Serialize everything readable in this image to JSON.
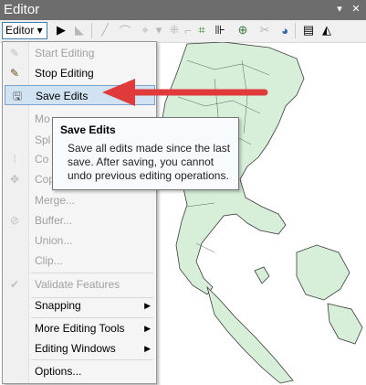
{
  "window": {
    "title": "Editor",
    "controls": [
      "▾",
      "✕"
    ]
  },
  "toolbar": {
    "editor_label": "Editor ▾"
  },
  "menu": {
    "items": [
      {
        "label": "Start Editing",
        "enabled": false,
        "icon": "pencil-icon"
      },
      {
        "label": "Stop Editing",
        "enabled": true,
        "icon": "pencil-stop-icon"
      },
      {
        "label": "Save Edits",
        "enabled": true,
        "icon": "save-edits-icon",
        "highlighted": true
      },
      {
        "label": "Mo",
        "enabled": false
      },
      {
        "label": "Spl",
        "enabled": false
      },
      {
        "label": "Co",
        "enabled": false
      },
      {
        "label": "Cop",
        "enabled": false
      },
      {
        "label": "Merge...",
        "enabled": false
      },
      {
        "label": "Buffer...",
        "enabled": false
      },
      {
        "label": "Union...",
        "enabled": false
      },
      {
        "label": "Clip...",
        "enabled": false
      },
      {
        "label": "Validate Features",
        "enabled": false
      },
      {
        "label": "Snapping",
        "enabled": true,
        "submenu": true
      },
      {
        "label": "More Editing Tools",
        "enabled": true,
        "submenu": true
      },
      {
        "label": "Editing Windows",
        "enabled": true,
        "submenu": true
      },
      {
        "label": "Options...",
        "enabled": true
      }
    ]
  },
  "tooltip": {
    "title": "Save Edits",
    "line1": "Save all edits made since the last",
    "line2": "save. After saving, you cannot",
    "line3": "undo previous editing operations."
  },
  "colors": {
    "titlebar": "#6d6d6d",
    "highlight": "#d1e2f2",
    "arrow": "#e03a3a",
    "land": "#d7efd9"
  }
}
